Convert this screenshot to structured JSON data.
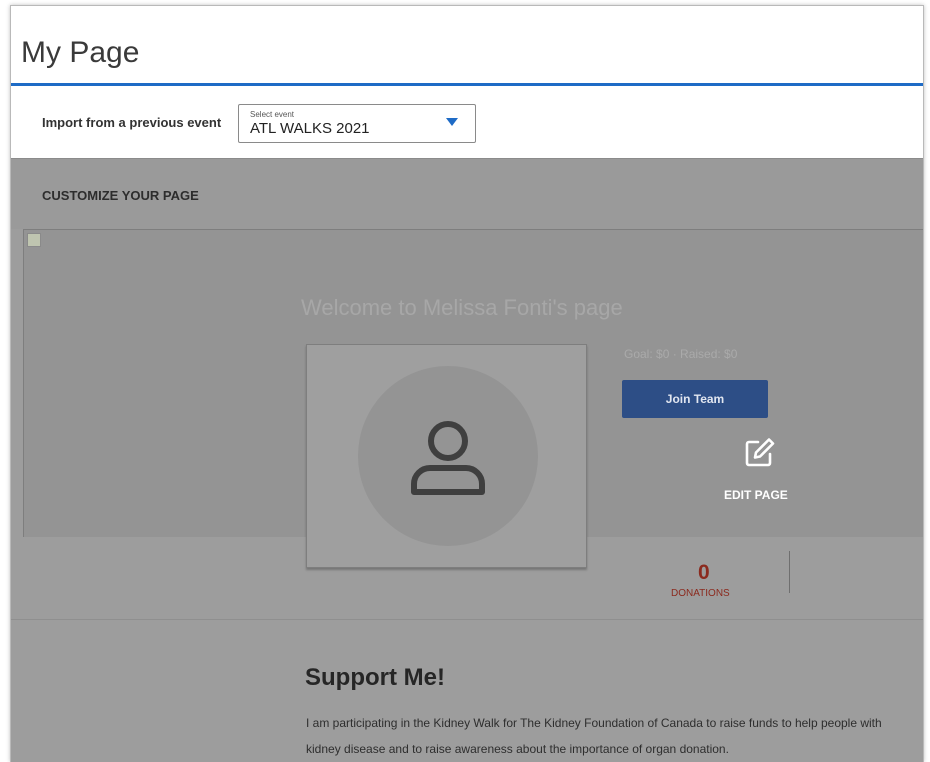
{
  "page": {
    "title": "My Page"
  },
  "import": {
    "label": "Import from a previous event",
    "select_caption": "Select event",
    "select_value": "ATL WALKS 2021"
  },
  "customize": {
    "label": "CUSTOMIZE YOUR PAGE"
  },
  "banner": {
    "welcome": "Welcome to Melissa Fonti's page",
    "subline": "Goal: $0 · Raised: $0",
    "join_button": "Join Team",
    "edit_label": "EDIT PAGE"
  },
  "stats": {
    "donations_count": "0",
    "donations_label": "DONATIONS"
  },
  "support": {
    "title": "Support Me!",
    "text": "I am participating in the Kidney Walk for The Kidney Foundation of Canada to raise funds to help people with kidney disease and to raise awareness about the importance of organ donation."
  },
  "colors": {
    "accent": "#1e6bc6",
    "join_button": "#2d4e86",
    "donations": "#8b2a1e"
  },
  "icons": [
    "broken-image-icon",
    "dropdown-caret-icon",
    "edit-icon",
    "user-avatar-icon"
  ]
}
